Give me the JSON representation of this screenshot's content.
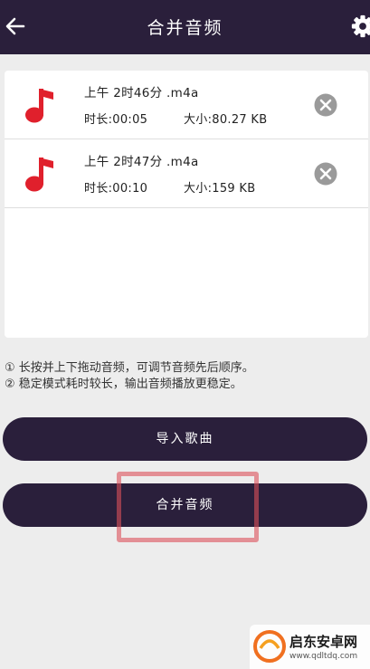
{
  "header": {
    "title": "合并音频",
    "back_icon": "arrow-left-icon",
    "settings_icon": "gear-icon"
  },
  "files": [
    {
      "name": "上午 2时46分 .m4a",
      "duration": "时长:00:05",
      "size": "大小:80.27 KB"
    },
    {
      "name": "上午 2时47分 .m4a",
      "duration": "时长:00:10",
      "size": "大小:159 KB"
    }
  ],
  "hints": [
    "① 长按并上下拖动音频，可调节音频先后顺序。",
    "② 稳定模式耗时较长，输出音频播放更稳定。"
  ],
  "buttons": {
    "import_label": "导入歌曲",
    "merge_label": "合并音频"
  },
  "watermark": {
    "name": "启东安卓网",
    "url": "www.qdltdq.com"
  },
  "colors": {
    "primary": "#2a1f3b",
    "note": "#e0202c",
    "highlight": "#dc505a"
  }
}
